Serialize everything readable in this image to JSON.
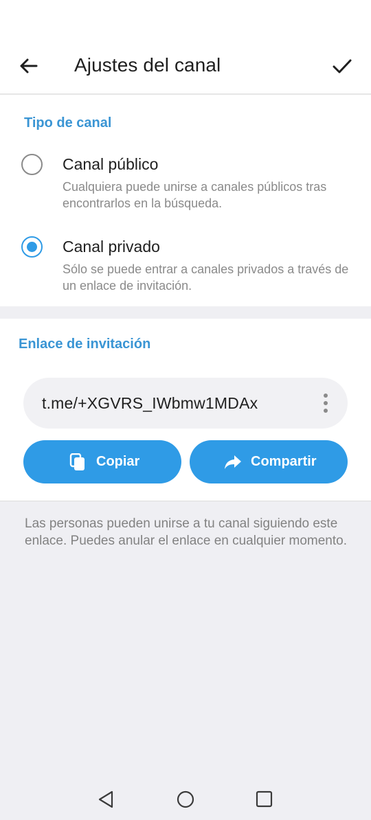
{
  "header": {
    "title": "Ajustes del canal",
    "back_icon": "arrow-left-icon",
    "done_icon": "checkmark-icon"
  },
  "channel_type": {
    "header": "Tipo de canal",
    "options": [
      {
        "label": "Canal público",
        "description": "Cualquiera puede unirse a canales públicos tras encontrarlos en la búsqueda.",
        "selected": false
      },
      {
        "label": "Canal privado",
        "description": "Sólo se puede entrar a canales privados a través de un enlace de invitación.",
        "selected": true
      }
    ]
  },
  "invite_link": {
    "header": "Enlace de invitación",
    "link": "t.me/+XGVRS_IWbmw1MDAx",
    "copy_label": "Copiar",
    "share_label": "Compartir",
    "footnote": "Las personas pueden unirse a tu canal siguiendo este enlace. Puedes anular el enlace en cualquier momento."
  },
  "colors": {
    "accent": "#2f9be6",
    "section_header": "#3a95d4",
    "background": "#efeff3"
  },
  "system_nav": {
    "icons": [
      "back-triangle-icon",
      "home-circle-icon",
      "recents-square-icon"
    ]
  }
}
